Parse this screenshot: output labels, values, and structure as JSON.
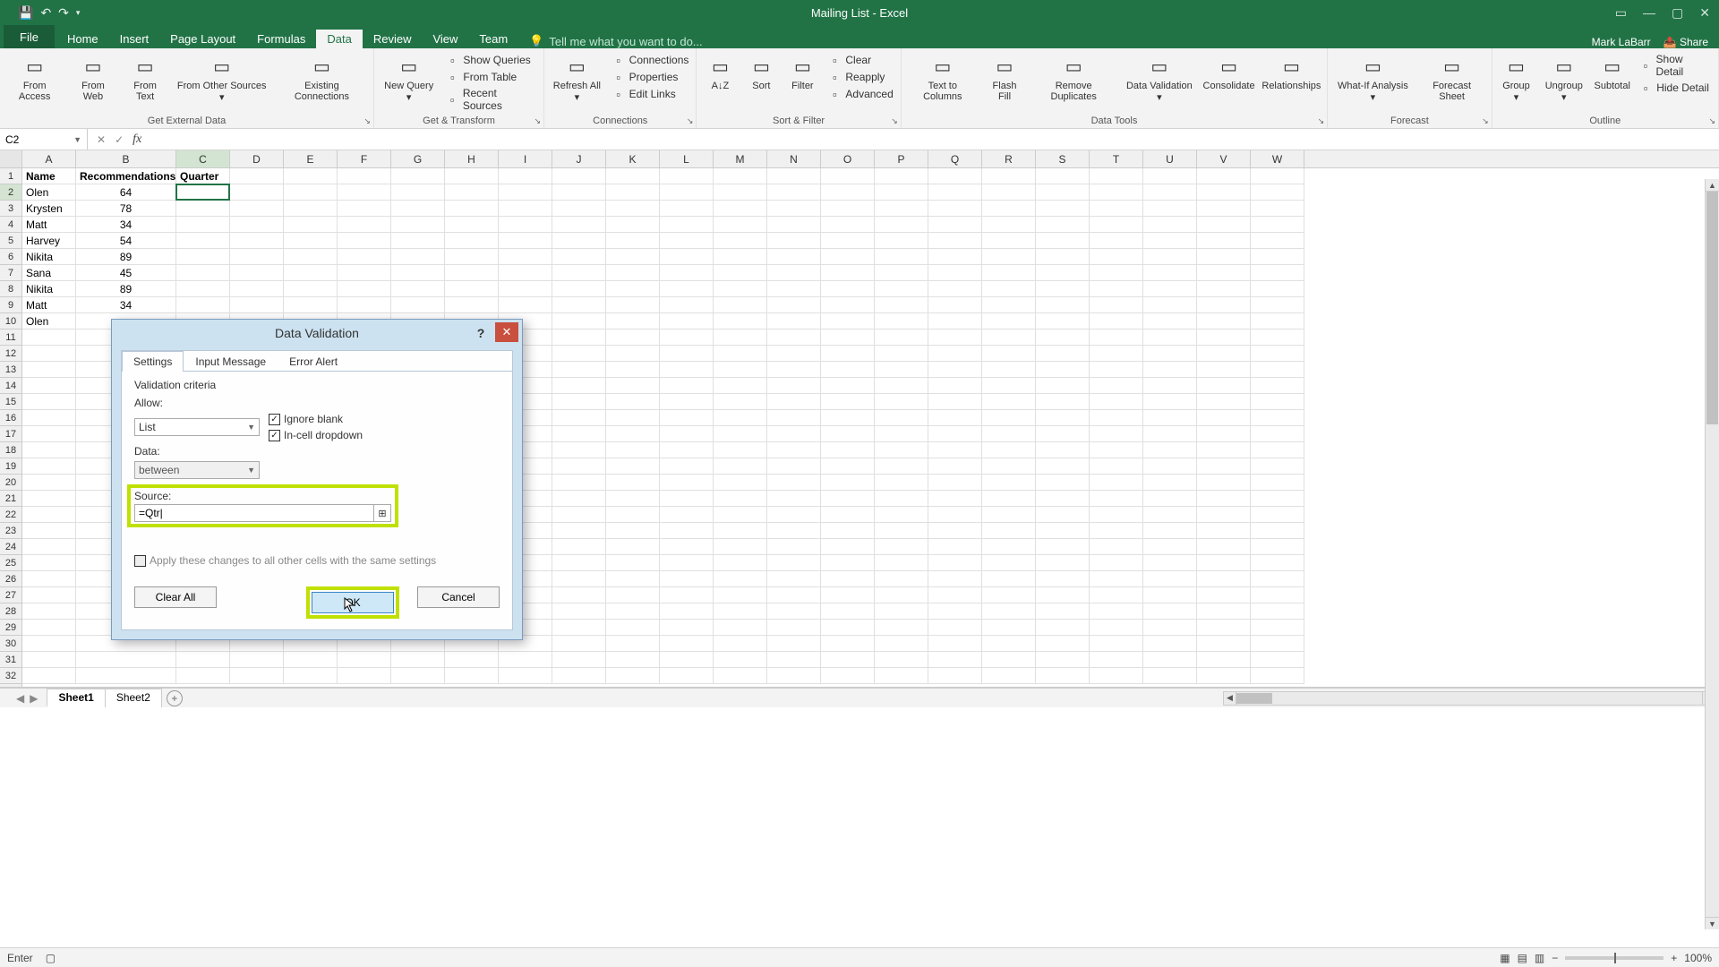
{
  "app": {
    "title": "Mailing List - Excel",
    "user": "Mark LaBarr",
    "share": "Share"
  },
  "qat": {
    "save": "save-icon",
    "undo": "↶",
    "redo": "↷"
  },
  "tabs": {
    "file": "File",
    "items": [
      "Home",
      "Insert",
      "Page Layout",
      "Formulas",
      "Data",
      "Review",
      "View",
      "Team"
    ],
    "active": "Data",
    "tellme": "Tell me what you want to do..."
  },
  "ribbon": {
    "groups": [
      {
        "label": "Get External Data",
        "big": [
          {
            "label": "From Access"
          },
          {
            "label": "From Web"
          },
          {
            "label": "From Text"
          },
          {
            "label": "From Other Sources ▾"
          },
          {
            "label": "Existing Connections"
          }
        ]
      },
      {
        "label": "Get & Transform",
        "big": [
          {
            "label": "New Query ▾"
          }
        ],
        "stack": [
          {
            "label": "Show Queries"
          },
          {
            "label": "From Table"
          },
          {
            "label": "Recent Sources"
          }
        ]
      },
      {
        "label": "Connections",
        "big": [
          {
            "label": "Refresh All ▾"
          }
        ],
        "stack": [
          {
            "label": "Connections"
          },
          {
            "label": "Properties"
          },
          {
            "label": "Edit Links"
          }
        ]
      },
      {
        "label": "Sort & Filter",
        "big": [
          {
            "label": "A↓Z"
          },
          {
            "label": "Sort"
          },
          {
            "label": "Filter"
          }
        ],
        "stack": [
          {
            "label": "Clear"
          },
          {
            "label": "Reapply"
          },
          {
            "label": "Advanced"
          }
        ]
      },
      {
        "label": "Data Tools",
        "big": [
          {
            "label": "Text to Columns"
          },
          {
            "label": "Flash Fill"
          },
          {
            "label": "Remove Duplicates"
          },
          {
            "label": "Data Validation ▾"
          },
          {
            "label": "Consolidate"
          },
          {
            "label": "Relationships"
          }
        ]
      },
      {
        "label": "Forecast",
        "big": [
          {
            "label": "What-If Analysis ▾"
          },
          {
            "label": "Forecast Sheet"
          }
        ]
      },
      {
        "label": "Outline",
        "big": [
          {
            "label": "Group ▾"
          },
          {
            "label": "Ungroup ▾"
          },
          {
            "label": "Subtotal"
          }
        ],
        "stack": [
          {
            "label": "Show Detail"
          },
          {
            "label": "Hide Detail"
          }
        ]
      }
    ]
  },
  "namebox": "C2",
  "formula": "",
  "columns": [
    "A",
    "B",
    "C",
    "D",
    "E",
    "F",
    "G",
    "H",
    "I",
    "J",
    "K",
    "L",
    "M",
    "N",
    "O",
    "P",
    "Q",
    "R",
    "S",
    "T",
    "U",
    "V",
    "W"
  ],
  "rows_visible": 32,
  "headers": [
    "Name",
    "Recommendations",
    "Quarter"
  ],
  "data_rows": [
    [
      "Olen",
      "64",
      ""
    ],
    [
      "Krysten",
      "78",
      ""
    ],
    [
      "Matt",
      "34",
      ""
    ],
    [
      "Harvey",
      "54",
      ""
    ],
    [
      "Nikita",
      "89",
      ""
    ],
    [
      "Sana",
      "45",
      ""
    ],
    [
      "Nikita",
      "89",
      ""
    ],
    [
      "Matt",
      "34",
      ""
    ],
    [
      "Olen",
      "",
      ""
    ]
  ],
  "active_cell": {
    "col": "C",
    "row": 2
  },
  "sheets": {
    "items": [
      "Sheet1",
      "Sheet2"
    ],
    "active": "Sheet1"
  },
  "status": {
    "mode": "Enter",
    "zoom": "100%"
  },
  "dialog": {
    "title": "Data Validation",
    "tabs": [
      "Settings",
      "Input Message",
      "Error Alert"
    ],
    "active_tab": "Settings",
    "section": "Validation criteria",
    "allow_label": "Allow:",
    "allow_value": "List",
    "ignore_blank": "Ignore blank",
    "incell": "In-cell dropdown",
    "data_label": "Data:",
    "data_value": "between",
    "source_label": "Source:",
    "source_value": "=Qtr|",
    "apply": "Apply these changes to all other cells with the same settings",
    "clear": "Clear All",
    "ok": "OK",
    "cancel": "Cancel"
  }
}
